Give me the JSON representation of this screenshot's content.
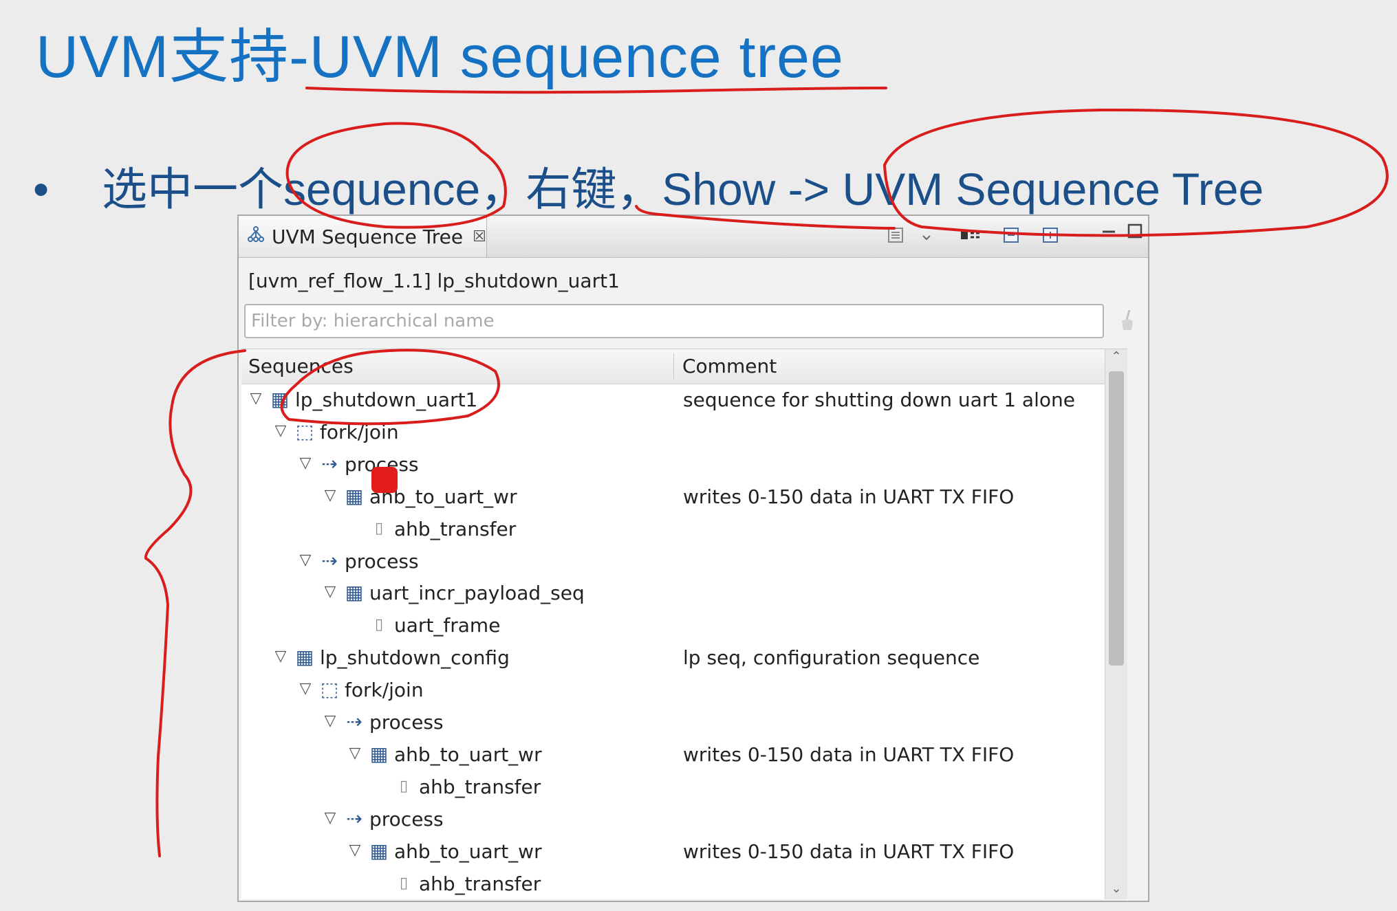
{
  "slide": {
    "title": "UVM支持-UVM sequence tree",
    "bullet": "•",
    "instruction": "选中一个sequence，右键，Show -> UVM Sequence Tree"
  },
  "view": {
    "tab_label": "UVM Sequence Tree",
    "tab_close": "☒",
    "breadcrumb": "[uvm_ref_flow_1.1] lp_shutdown_uart1",
    "filter_placeholder": "Filter by: hierarchical name",
    "columns": {
      "sequences": "Sequences",
      "comment": "Comment"
    },
    "toolbar": {
      "view_menu_icon": "list-icon",
      "dropdown_icon": "chevron-down-icon",
      "layout_icon": "layout-icon",
      "collapse_icon": "collapse-all-icon",
      "expand_icon": "expand-all-icon",
      "minimize_icon": "minimize-icon",
      "maximize_icon": "maximize-icon"
    },
    "rows": [
      {
        "label": "lp_shutdown_uart1",
        "comment": "sequence for shutting down uart 1 alone",
        "kind": "sequence",
        "depth": 0
      },
      {
        "label": "fork/join",
        "comment": "",
        "kind": "forkjoin",
        "depth": 1
      },
      {
        "label": "process",
        "comment": "",
        "kind": "process",
        "depth": 2
      },
      {
        "label": "ahb_to_uart_wr",
        "comment": "writes 0-150 data in UART TX FIFO",
        "kind": "sequence",
        "depth": 3
      },
      {
        "label": "ahb_transfer",
        "comment": "",
        "kind": "item",
        "depth": 4
      },
      {
        "label": "process",
        "comment": "",
        "kind": "process",
        "depth": 2
      },
      {
        "label": "uart_incr_payload_seq",
        "comment": "",
        "kind": "sequence",
        "depth": 3
      },
      {
        "label": "uart_frame",
        "comment": "",
        "kind": "item",
        "depth": 4
      },
      {
        "label": "lp_shutdown_config",
        "comment": "lp seq, configuration sequence",
        "kind": "sequence",
        "depth": 1
      },
      {
        "label": "fork/join",
        "comment": "",
        "kind": "forkjoin",
        "depth": 2
      },
      {
        "label": "process",
        "comment": "",
        "kind": "process",
        "depth": 3
      },
      {
        "label": "ahb_to_uart_wr",
        "comment": "writes 0-150 data in UART TX FIFO",
        "kind": "sequence",
        "depth": 4
      },
      {
        "label": "ahb_transfer",
        "comment": "",
        "kind": "item",
        "depth": 5
      },
      {
        "label": "process",
        "comment": "",
        "kind": "process",
        "depth": 3
      },
      {
        "label": "ahb_to_uart_wr",
        "comment": "writes 0-150 data in UART TX FIFO",
        "kind": "sequence",
        "depth": 4
      },
      {
        "label": "ahb_transfer",
        "comment": "",
        "kind": "item",
        "depth": 5
      }
    ]
  },
  "colors": {
    "title": "#1572c2",
    "bullet_text": "#1b4f8a",
    "annotation": "#d91c1c"
  }
}
